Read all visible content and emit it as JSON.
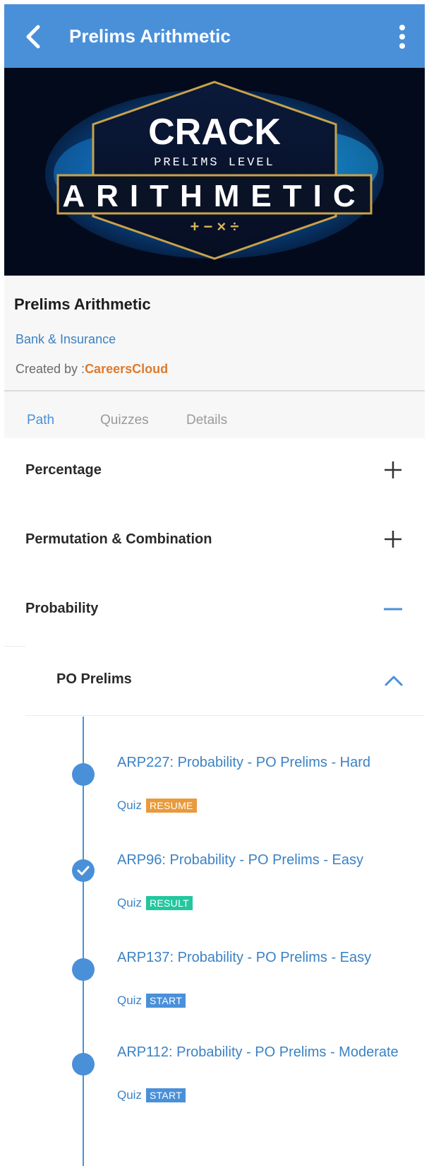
{
  "header": {
    "title": "Prelims Arithmetic",
    "back_icon": "chevron-left-icon",
    "menu_icon": "more-vertical-icon"
  },
  "banner": {
    "line1": "CRACK",
    "line2": "PRELIMS LEVEL",
    "line3": "ARITHMETIC",
    "line4": "+ − × ÷"
  },
  "course": {
    "title": "Prelims Arithmetic",
    "category": "Bank & Insurance",
    "created_by_label": "Created by :",
    "creator": "CareersCloud"
  },
  "tabs": [
    {
      "label": "Path",
      "active": true
    },
    {
      "label": "Quizzes",
      "active": false
    },
    {
      "label": "Details",
      "active": false
    }
  ],
  "sections": [
    {
      "label": "Percentage",
      "icon": "plus-icon"
    },
    {
      "label": "Permutation & Combination",
      "icon": "plus-icon"
    },
    {
      "label": "Probability",
      "icon": "minus-icon"
    }
  ],
  "subsection": {
    "label": "PO Prelims",
    "icon": "chevron-up-icon"
  },
  "items": [
    {
      "title": "ARP227: Probability - PO Prelims - Hard",
      "type": "Quiz",
      "action": "RESUME",
      "status": "in-progress"
    },
    {
      "title": "ARP96: Probability - PO Prelims - Easy",
      "type": "Quiz",
      "action": "RESULT",
      "status": "completed"
    },
    {
      "title": "ARP137: Probability - PO Prelims - Easy",
      "type": "Quiz",
      "action": "START",
      "status": "not-started"
    },
    {
      "title": "ARP112: Probability - PO Prelims - Moderate",
      "type": "Quiz",
      "action": "START",
      "status": "not-started"
    }
  ],
  "colors": {
    "primary": "#4a90d9",
    "resume": "#e89a3c",
    "result": "#22c7a0",
    "creator": "#e07a2a"
  }
}
